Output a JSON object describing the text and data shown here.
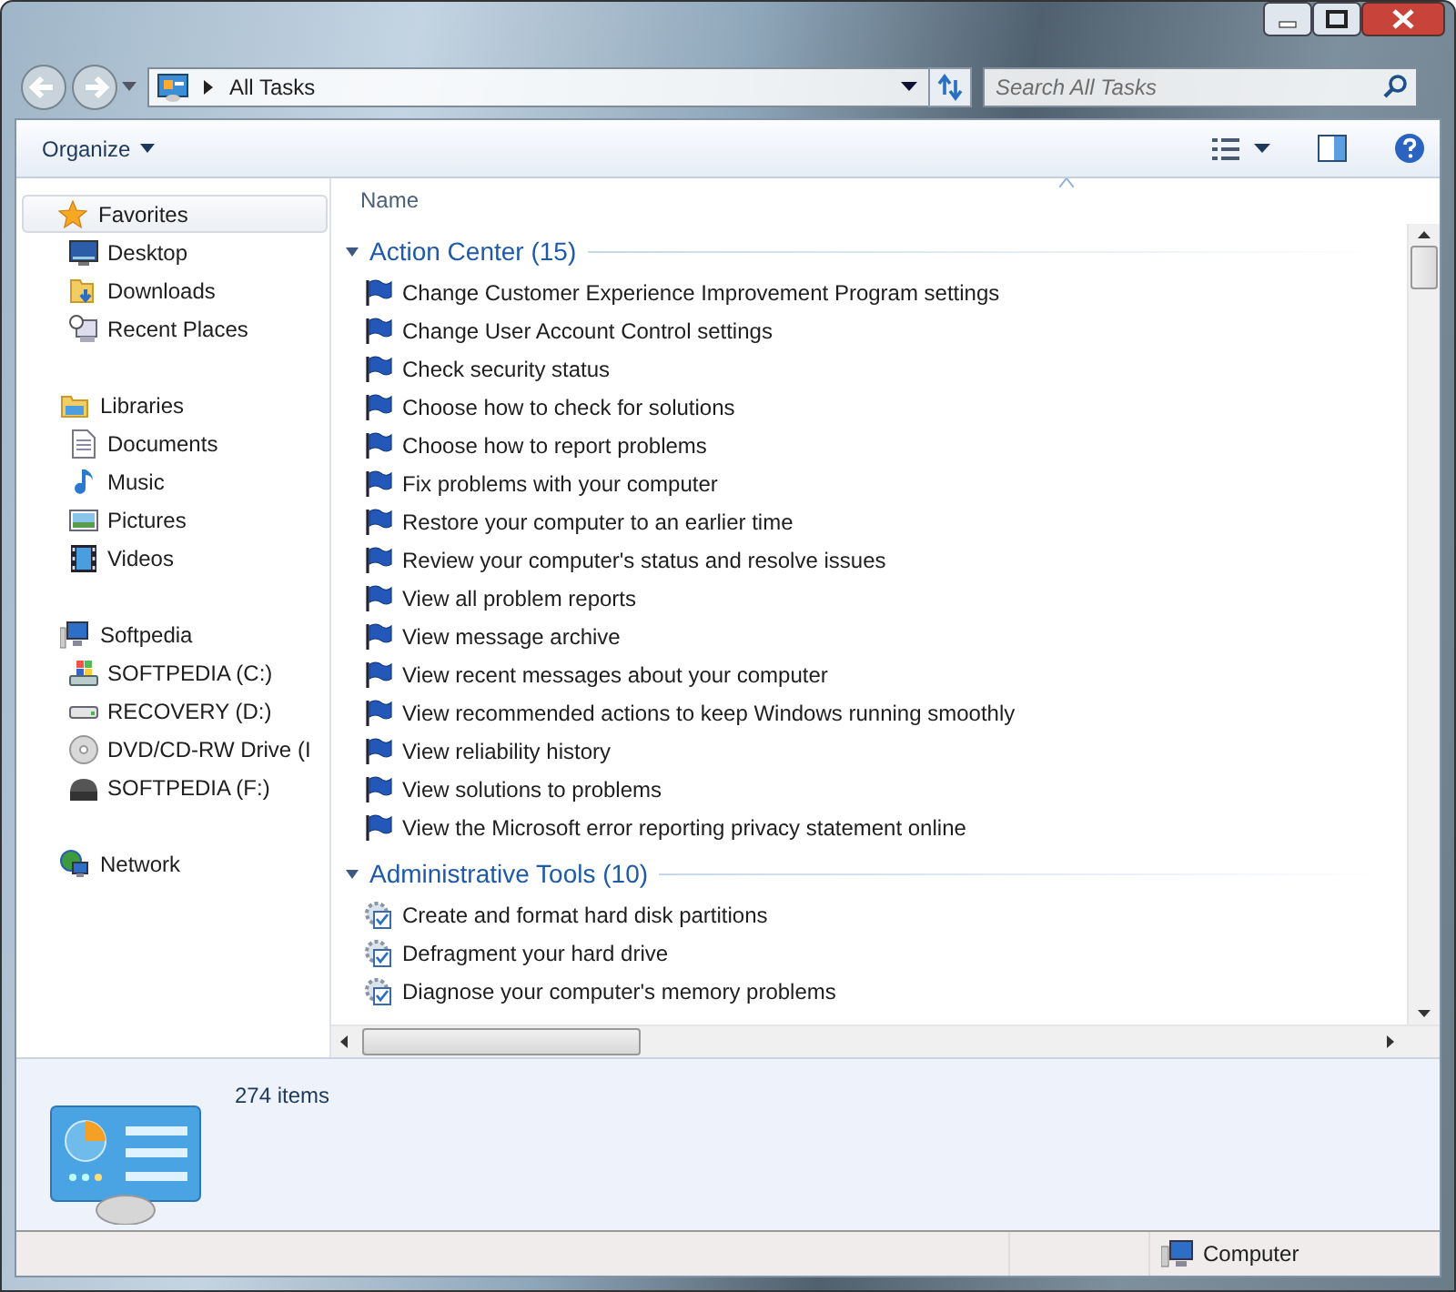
{
  "address": {
    "path": "All Tasks"
  },
  "search": {
    "placeholder": "Search All Tasks"
  },
  "toolbar": {
    "organize": "Organize"
  },
  "sidebar": {
    "groups": [
      {
        "label": "Favorites",
        "kind": "star",
        "selected": true,
        "items": [
          {
            "label": "Desktop",
            "kind": "desktop"
          },
          {
            "label": "Downloads",
            "kind": "downloads"
          },
          {
            "label": "Recent Places",
            "kind": "recent"
          }
        ]
      },
      {
        "label": "Libraries",
        "kind": "library",
        "selected": false,
        "items": [
          {
            "label": "Documents",
            "kind": "document"
          },
          {
            "label": "Music",
            "kind": "music"
          },
          {
            "label": "Pictures",
            "kind": "pictures"
          },
          {
            "label": "Videos",
            "kind": "videos"
          }
        ]
      },
      {
        "label": "Softpedia",
        "kind": "computer",
        "selected": false,
        "items": [
          {
            "label": "SOFTPEDIA (C:)",
            "kind": "windrive"
          },
          {
            "label": "RECOVERY (D:)",
            "kind": "drive"
          },
          {
            "label": "DVD/CD-RW Drive (I",
            "kind": "disc"
          },
          {
            "label": "SOFTPEDIA (F:)",
            "kind": "removable"
          }
        ]
      },
      {
        "label": "Network",
        "kind": "network",
        "selected": false
      }
    ]
  },
  "content": {
    "column": "Name",
    "groups": [
      {
        "title": "Action Center",
        "count": "(15)",
        "items": [
          {
            "label": "Change Customer Experience Improvement Program settings",
            "kind": "flag"
          },
          {
            "label": "Change User Account Control settings",
            "kind": "flag"
          },
          {
            "label": "Check security status",
            "kind": "flag"
          },
          {
            "label": "Choose how to check for solutions",
            "kind": "flag"
          },
          {
            "label": "Choose how to report problems",
            "kind": "flag"
          },
          {
            "label": "Fix problems with your computer",
            "kind": "flag"
          },
          {
            "label": "Restore your computer to an earlier time",
            "kind": "flag"
          },
          {
            "label": "Review your computer's status and resolve issues",
            "kind": "flag"
          },
          {
            "label": "View all problem reports",
            "kind": "flag"
          },
          {
            "label": "View message archive",
            "kind": "flag"
          },
          {
            "label": "View recent messages about your computer",
            "kind": "flag"
          },
          {
            "label": "View recommended actions to keep Windows running smoothly",
            "kind": "flag"
          },
          {
            "label": "View reliability history",
            "kind": "flag"
          },
          {
            "label": "View solutions to problems",
            "kind": "flag"
          },
          {
            "label": "View the Microsoft error reporting privacy statement online",
            "kind": "flag"
          }
        ]
      },
      {
        "title": "Administrative Tools",
        "count": "(10)",
        "items": [
          {
            "label": "Create and format hard disk partitions",
            "kind": "tool"
          },
          {
            "label": "Defragment your hard drive",
            "kind": "tool"
          },
          {
            "label": "Diagnose your computer's memory problems",
            "kind": "tool"
          }
        ]
      }
    ]
  },
  "details": {
    "count": "274 items"
  },
  "status": {
    "location": "Computer"
  }
}
